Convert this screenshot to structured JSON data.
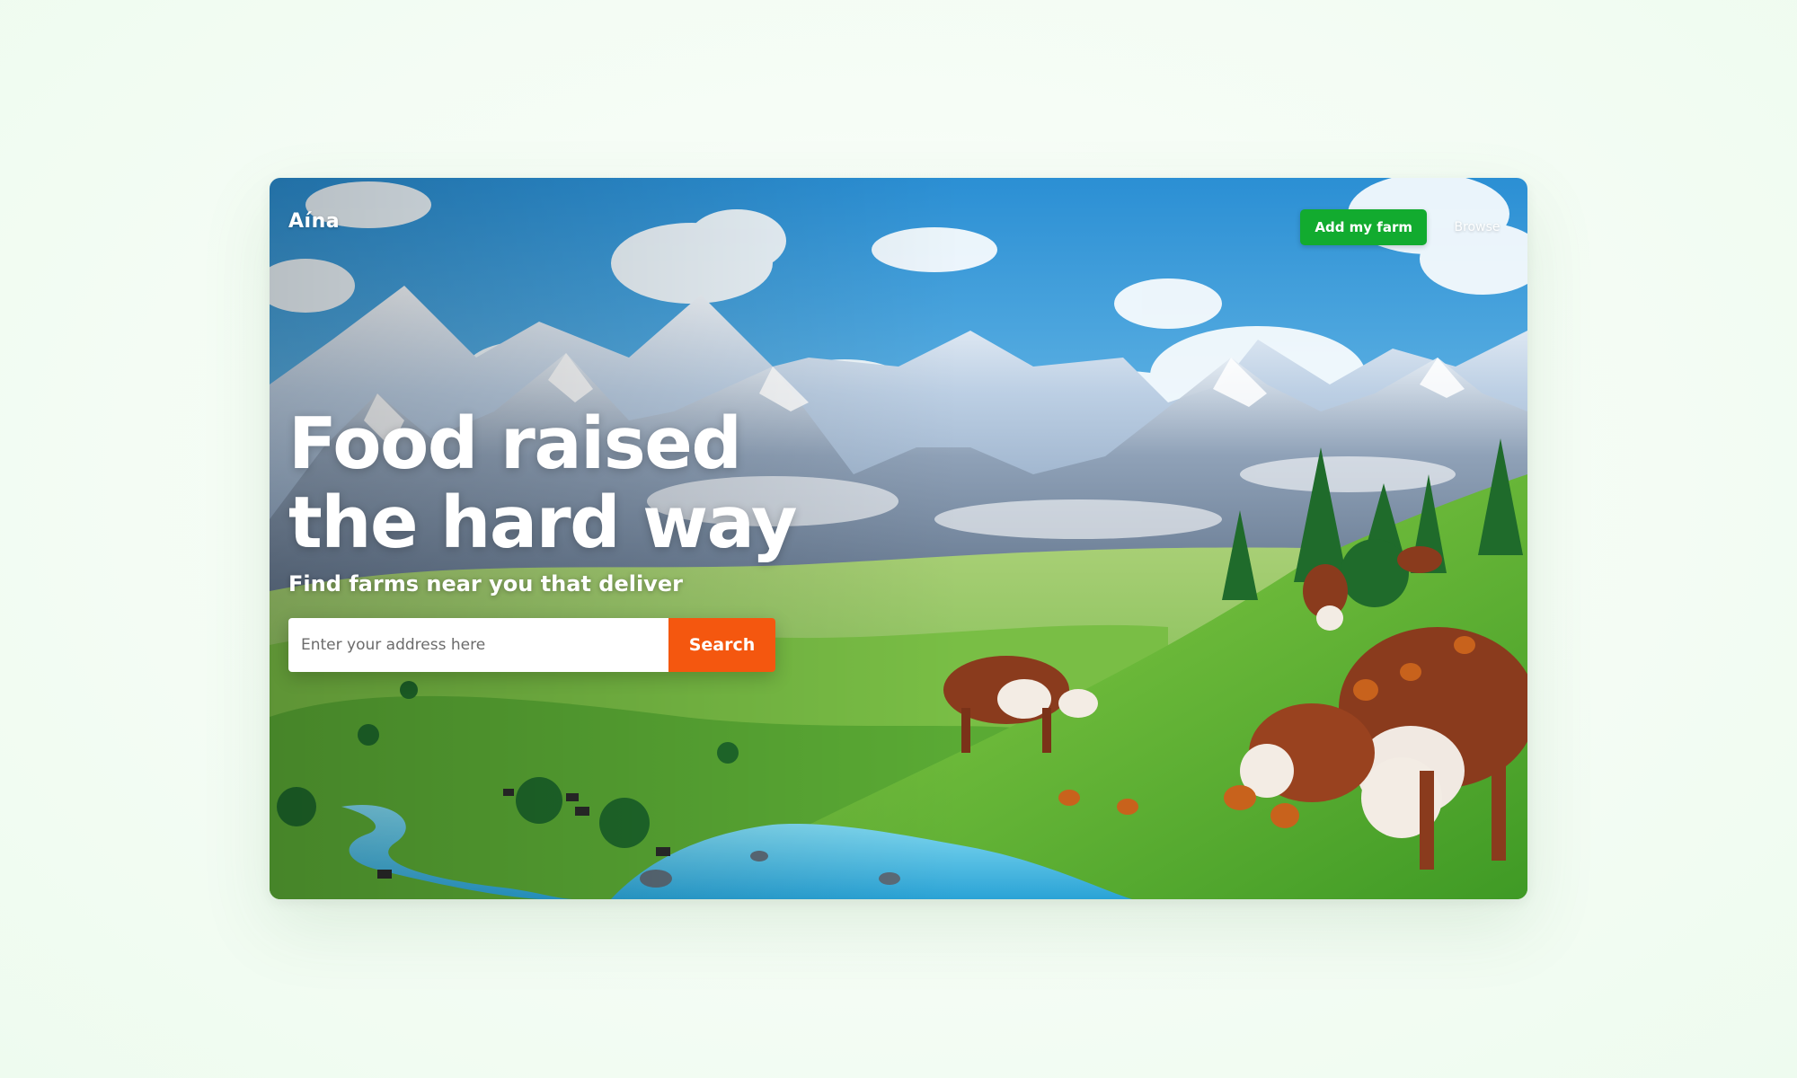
{
  "brand": {
    "logo": "Aína"
  },
  "nav": {
    "add_farm_label": "Add my farm",
    "browse_label": "Browse"
  },
  "hero": {
    "headline_line1": "Food raised",
    "headline_line2": "the hard way",
    "subheadline": "Find farms near you that deliver"
  },
  "search": {
    "value": "",
    "placeholder": "Enter your address here",
    "button_label": "Search"
  },
  "colors": {
    "primary_green": "#12ab2f",
    "accent_orange": "#f4570f",
    "page_background": "#f2fcf2"
  }
}
